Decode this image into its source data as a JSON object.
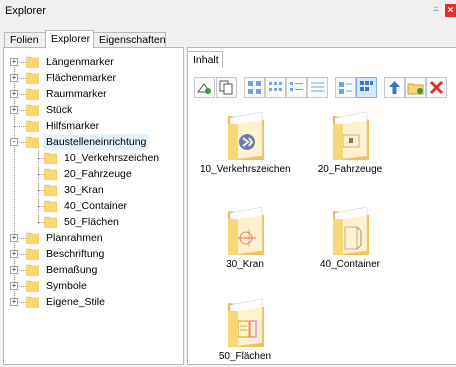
{
  "window": {
    "title": "Explorer",
    "pin_glyph": "⍨",
    "close_glyph": "×"
  },
  "tabs": [
    {
      "label": "Folien",
      "active": false
    },
    {
      "label": "Explorer",
      "active": true
    },
    {
      "label": "Eigenschaften",
      "active": false
    }
  ],
  "tree": {
    "items": [
      {
        "label": "Längenmarker",
        "expander": "+"
      },
      {
        "label": "Flächenmarker",
        "expander": "+"
      },
      {
        "label": "Raummarker",
        "expander": "+"
      },
      {
        "label": "Stück",
        "expander": "+"
      },
      {
        "label": "Hilfsmarker",
        "expander": ""
      },
      {
        "label": "Baustelleneinrichtung",
        "expander": "-",
        "selected": true
      },
      {
        "label": "10_Verkehrszeichen",
        "child": true
      },
      {
        "label": "20_Fahrzeuge",
        "child": true
      },
      {
        "label": "30_Kran",
        "child": true
      },
      {
        "label": "40_Container",
        "child": true
      },
      {
        "label": "50_Flächen",
        "child": true
      },
      {
        "label": "Planrahmen",
        "expander": "+"
      },
      {
        "label": "Beschriftung",
        "expander": "+"
      },
      {
        "label": "Bemaßung",
        "expander": "+"
      },
      {
        "label": "Symbole",
        "expander": "+"
      },
      {
        "label": "Eigene_Stile",
        "expander": "+"
      }
    ]
  },
  "content": {
    "tab_label": "Inhalt",
    "items": [
      {
        "label": "10_Verkehrszeichen"
      },
      {
        "label": "20_Fahrzeuge"
      },
      {
        "label": "30_Kran"
      },
      {
        "label": "40_Container"
      },
      {
        "label": "50_Flächen"
      }
    ]
  },
  "colors": {
    "folder": "#f8d775",
    "folder_dark": "#e9b949",
    "selection": "#e5f1fb",
    "close": "#dd3333"
  }
}
